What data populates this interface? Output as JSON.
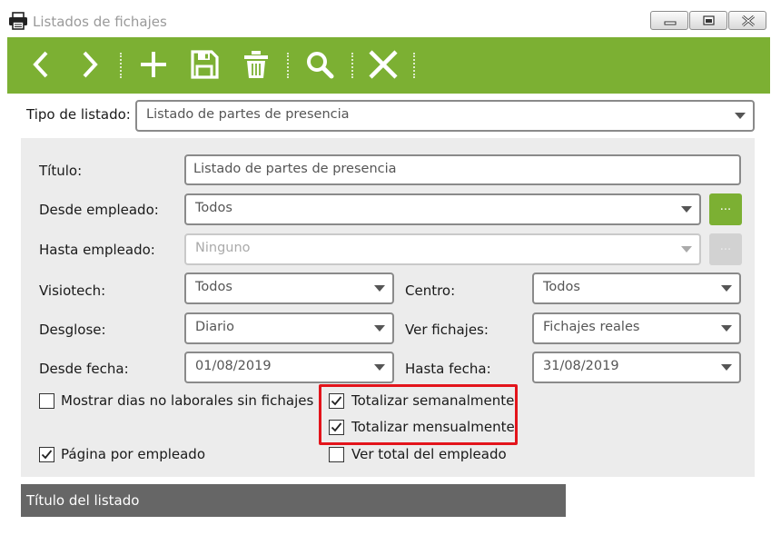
{
  "window": {
    "title": "Listados de fichajes"
  },
  "toolbar": {
    "buttons": [
      {
        "name": "back",
        "icon": "chevron-left-icon"
      },
      {
        "name": "forward",
        "icon": "chevron-right-icon"
      },
      {
        "name": "add",
        "icon": "plus-icon"
      },
      {
        "name": "save",
        "icon": "floppy-disk-icon"
      },
      {
        "name": "delete",
        "icon": "trash-icon"
      },
      {
        "name": "search",
        "icon": "search-icon"
      },
      {
        "name": "close",
        "icon": "close-icon"
      }
    ]
  },
  "colors": {
    "toolbar": "#7cb033",
    "panel": "#ececec",
    "highlight": "#e3141b",
    "footer": "#666666"
  },
  "form": {
    "tipo_label": "Tipo de listado:",
    "tipo_value": "Listado de partes de presencia",
    "titulo_label": "Título:",
    "titulo_value": "Listado de partes de presencia",
    "desde_empleado_label": "Desde empleado:",
    "desde_empleado_value": "Todos",
    "hasta_empleado_label": "Hasta empleado:",
    "hasta_empleado_value": "Ninguno",
    "ellipsis_label": "...",
    "visiotech_label": "Visiotech:",
    "visiotech_value": "Todos",
    "centro_label": "Centro:",
    "centro_value": "Todos",
    "desglose_label": "Desglose:",
    "desglose_value": "Diario",
    "ver_fichajes_label": "Ver fichajes:",
    "ver_fichajes_value": "Fichajes reales",
    "desde_fecha_label": "Desde fecha:",
    "desde_fecha_value": "01/08/2019",
    "hasta_fecha_label": "Hasta fecha:",
    "hasta_fecha_value": "31/08/2019"
  },
  "checkboxes": {
    "mostrar_dias": {
      "label": "Mostrar dias no laborales sin fichajes",
      "checked": false
    },
    "totalizar_semanal": {
      "label": "Totalizar semanalmente",
      "checked": true
    },
    "totalizar_mensual": {
      "label": "Totalizar mensualmente",
      "checked": true
    },
    "pagina_empleado": {
      "label": "Página por empleado",
      "checked": true
    },
    "ver_total": {
      "label": "Ver total del empleado",
      "checked": false
    }
  },
  "footer": {
    "title": "Título del listado"
  }
}
